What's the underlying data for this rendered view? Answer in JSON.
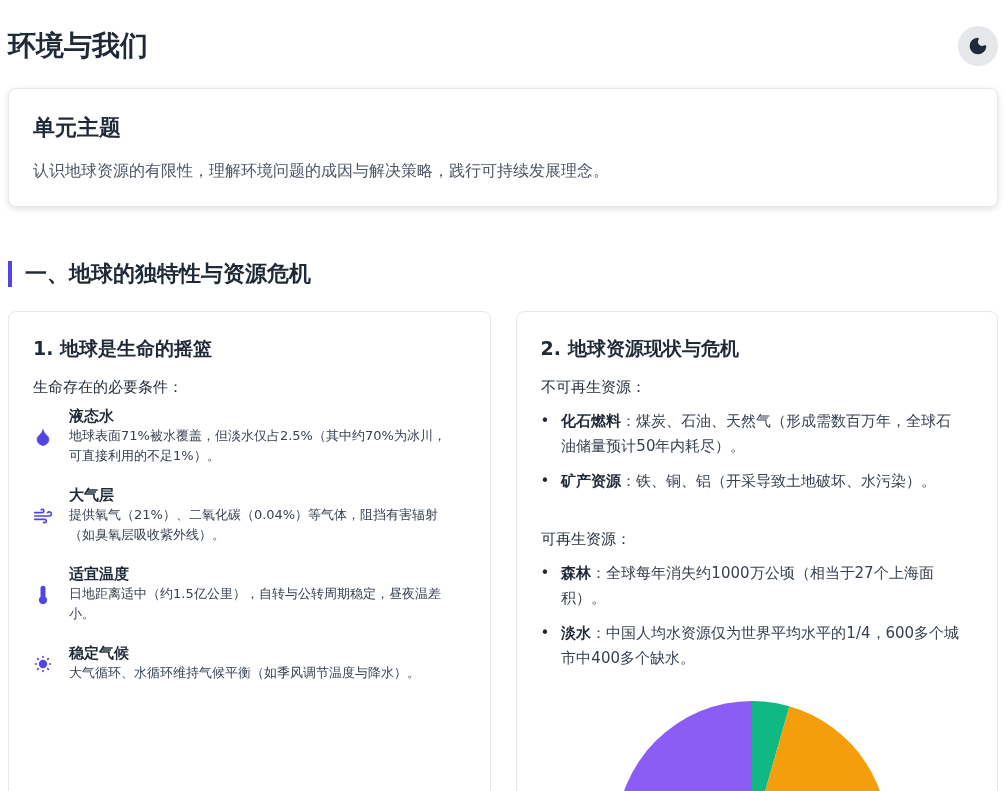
{
  "page_title": "环境与我们",
  "theme_toggle": {
    "dark_mode": false
  },
  "unit_card": {
    "title": "单元主题",
    "text": "认识地球资源的有限性，理解环境问题的成因与解决策略，践行可持续发展理念。"
  },
  "section": {
    "title": "一、地球的独特性与资源危机",
    "cards": [
      {
        "title": "1. 地球是生命的摇篮",
        "subtitle": "生命存在的必要条件：",
        "conditions": [
          {
            "kind": "water",
            "name": "液态水",
            "text": "地球表面71%被水覆盖，但淡水仅占2.5%（其中约70%为冰川，可直接利用的不足1%）。"
          },
          {
            "kind": "air",
            "name": "大气层",
            "text": "提供氧气（21%）、二氧化碳（0.04%）等气体，阻挡有害辐射（如臭氧层吸收紫外线）。"
          },
          {
            "kind": "temperature",
            "name": "适宜温度",
            "text": "日地距离适中（约1.5亿公里），自转与公转周期稳定，昼夜温差小。"
          },
          {
            "kind": "climate",
            "name": "稳定气候",
            "text": "大气循环、水循环维持气候平衡（如季风调节温度与降水）。"
          }
        ]
      },
      {
        "title": "2. 地球资源现状与危机",
        "groups": [
          {
            "heading": "不可再生资源：",
            "items": [
              {
                "marker": "•",
                "text": "**化石燃料**：煤炭、石油、天然气（形成需数百万年，全球石油储量预计50年内耗尽）。"
              },
              {
                "marker": "•",
                "text": "**矿产资源**：铁、铜、铝（开采导致土地破坏、水污染）。"
              }
            ]
          },
          {
            "heading": "可再生资源：",
            "items": [
              {
                "marker": "•",
                "text": "**森林**：全球每年消失约1000万公顷（相当于27个上海面积）。"
              },
              {
                "marker": "•",
                "text": "**淡水**：中国人均水资源仅为世界平均水平的1/4，600多个城市中400多个缺水。"
              }
            ]
          }
        ]
      }
    ]
  }
}
